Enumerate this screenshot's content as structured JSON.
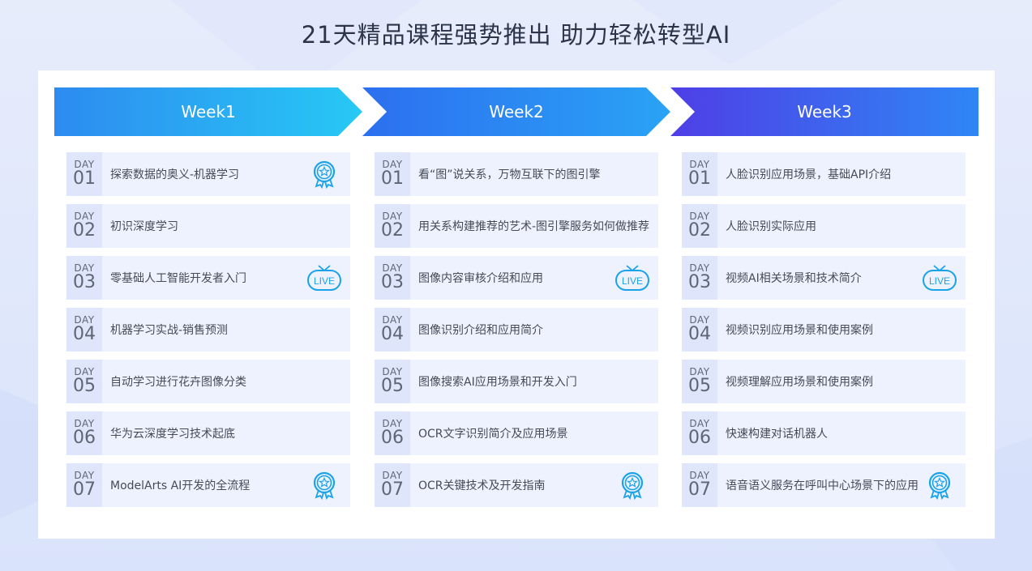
{
  "page": {
    "title": "21天精品课程强势推出 助力轻松转型AI"
  },
  "colors": {
    "accent_blue": "#1aa3e8",
    "week1": "#2d8bf0",
    "week2": "#2c6ff0",
    "week3": "#4e3fe6"
  },
  "weeks": [
    {
      "label": "Week1",
      "days": [
        {
          "day_label": "DAY",
          "num": "01",
          "text": "探索数据的奥义-机器学习",
          "icon": "badge-icon"
        },
        {
          "day_label": "DAY",
          "num": "02",
          "text": "初识深度学习",
          "icon": ""
        },
        {
          "day_label": "DAY",
          "num": "03",
          "text": "零基础人工智能开发者入门",
          "icon": "live-icon"
        },
        {
          "day_label": "DAY",
          "num": "04",
          "text": "机器学习实战-销售预测",
          "icon": ""
        },
        {
          "day_label": "DAY",
          "num": "05",
          "text": "自动学习进行花卉图像分类",
          "icon": ""
        },
        {
          "day_label": "DAY",
          "num": "06",
          "text": "华为云深度学习技术起底",
          "icon": ""
        },
        {
          "day_label": "DAY",
          "num": "07",
          "text": "ModelArts AI开发的全流程",
          "icon": "badge-icon"
        }
      ]
    },
    {
      "label": "Week2",
      "days": [
        {
          "day_label": "DAY",
          "num": "01",
          "text": "看“图”说关系，万物互联下的图引擎",
          "icon": ""
        },
        {
          "day_label": "DAY",
          "num": "02",
          "text": "用关系构建推荐的艺术-图引擎服务如何做推荐",
          "icon": ""
        },
        {
          "day_label": "DAY",
          "num": "03",
          "text": "图像内容审核介绍和应用",
          "icon": "live-icon"
        },
        {
          "day_label": "DAY",
          "num": "04",
          "text": "图像识别介绍和应用简介",
          "icon": ""
        },
        {
          "day_label": "DAY",
          "num": "05",
          "text": "图像搜索AI应用场景和开发入门",
          "icon": ""
        },
        {
          "day_label": "DAY",
          "num": "06",
          "text": "OCR文字识别简介及应用场景",
          "icon": ""
        },
        {
          "day_label": "DAY",
          "num": "07",
          "text": "OCR关键技术及开发指南",
          "icon": "badge-icon"
        }
      ]
    },
    {
      "label": "Week3",
      "days": [
        {
          "day_label": "DAY",
          "num": "01",
          "text": "人脸识别应用场景，基础API介绍",
          "icon": ""
        },
        {
          "day_label": "DAY",
          "num": "02",
          "text": "人脸识别实际应用",
          "icon": ""
        },
        {
          "day_label": "DAY",
          "num": "03",
          "text": "视频AI相关场景和技术简介",
          "icon": "live-icon"
        },
        {
          "day_label": "DAY",
          "num": "04",
          "text": "视频识别应用场景和使用案例",
          "icon": ""
        },
        {
          "day_label": "DAY",
          "num": "05",
          "text": "视频理解应用场景和使用案例",
          "icon": ""
        },
        {
          "day_label": "DAY",
          "num": "06",
          "text": "快速构建对话机器人",
          "icon": ""
        },
        {
          "day_label": "DAY",
          "num": "07",
          "text": "语音语义服务在呼叫中心场景下的应用",
          "icon": "badge-icon"
        }
      ]
    }
  ],
  "live_icon_text": "LIVE"
}
